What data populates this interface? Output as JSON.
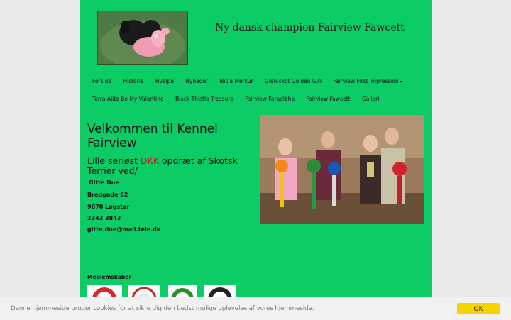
{
  "header": {
    "site_title": "Ny dansk champion Fairview Fawcett"
  },
  "nav": {
    "row1": [
      {
        "label": "Forside"
      },
      {
        "label": "Historie"
      },
      {
        "label": "Hvalpe"
      },
      {
        "label": "Nyheder"
      },
      {
        "label": "Nicla Merkur"
      },
      {
        "label": "Glen-skot Golden Girl"
      },
      {
        "label": "Fairview First Impression"
      }
    ],
    "row2": [
      {
        "label": "Terra Alite Be My Valentine"
      },
      {
        "label": "Black Thistle Treasure"
      },
      {
        "label": "Fairview Faradibha"
      },
      {
        "label": "Fairview Fawcett"
      },
      {
        "label": "Galleri"
      }
    ],
    "dropdown_icon": "chevron-down-icon"
  },
  "main": {
    "welcome_title": "Velkommen til Kennel Fairview",
    "subtitle_before": "Lille seriøst ",
    "subtitle_link": "DKK",
    "subtitle_after": " opdræt af Skotsk Terrier ved/",
    "contact": {
      "name": "Gitte Due",
      "street": "Bredgade 62",
      "city": "9670 Løgstør",
      "phone": "2343 3843",
      "email": "gitte.due@mail.tele.dk"
    },
    "memberships_label": "Medlemskaber"
  },
  "cookie": {
    "text": "Denne hjemmeside bruger cookies for at sikre dig den bedst mulige oplevelse af vores hjemmeside.",
    "ok_label": "OK"
  },
  "colors": {
    "page_background": "#0ccc66",
    "outer_background": "#e9e9e9",
    "link_accent": "#d81414",
    "ok_button": "#f5d400"
  }
}
